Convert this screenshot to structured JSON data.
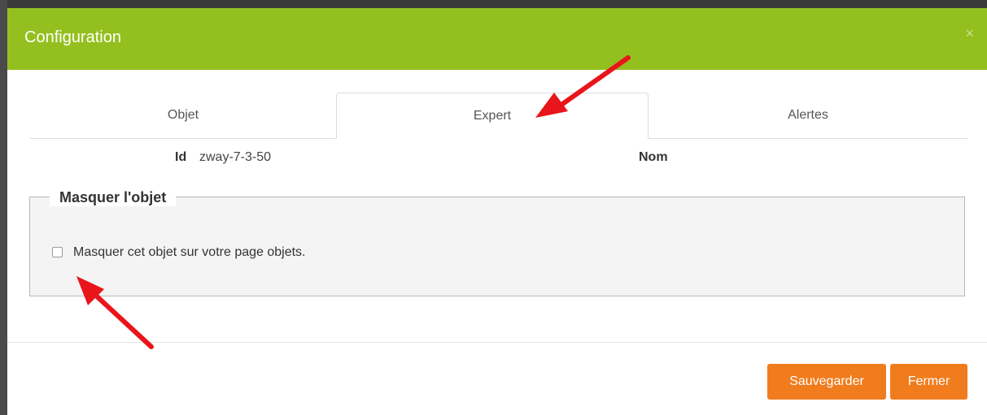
{
  "modal": {
    "title": "Configuration",
    "close_glyph": "×"
  },
  "tabs": [
    {
      "label": "Objet"
    },
    {
      "label": "Expert",
      "active": true
    },
    {
      "label": "Alertes"
    }
  ],
  "info": {
    "id_label": "Id",
    "id_value": "zway-7-3-50",
    "nom_label": "Nom"
  },
  "fieldset": {
    "legend": "Masquer l'objet",
    "checkbox_label": "Masquer cet objet sur votre page objets.",
    "checked": false
  },
  "footer": {
    "save_label": "Sauvegarder",
    "close_label": "Fermer"
  },
  "colors": {
    "header": "#93c01f",
    "button": "#f07c1e",
    "annotation_arrow": "#e8151b"
  }
}
